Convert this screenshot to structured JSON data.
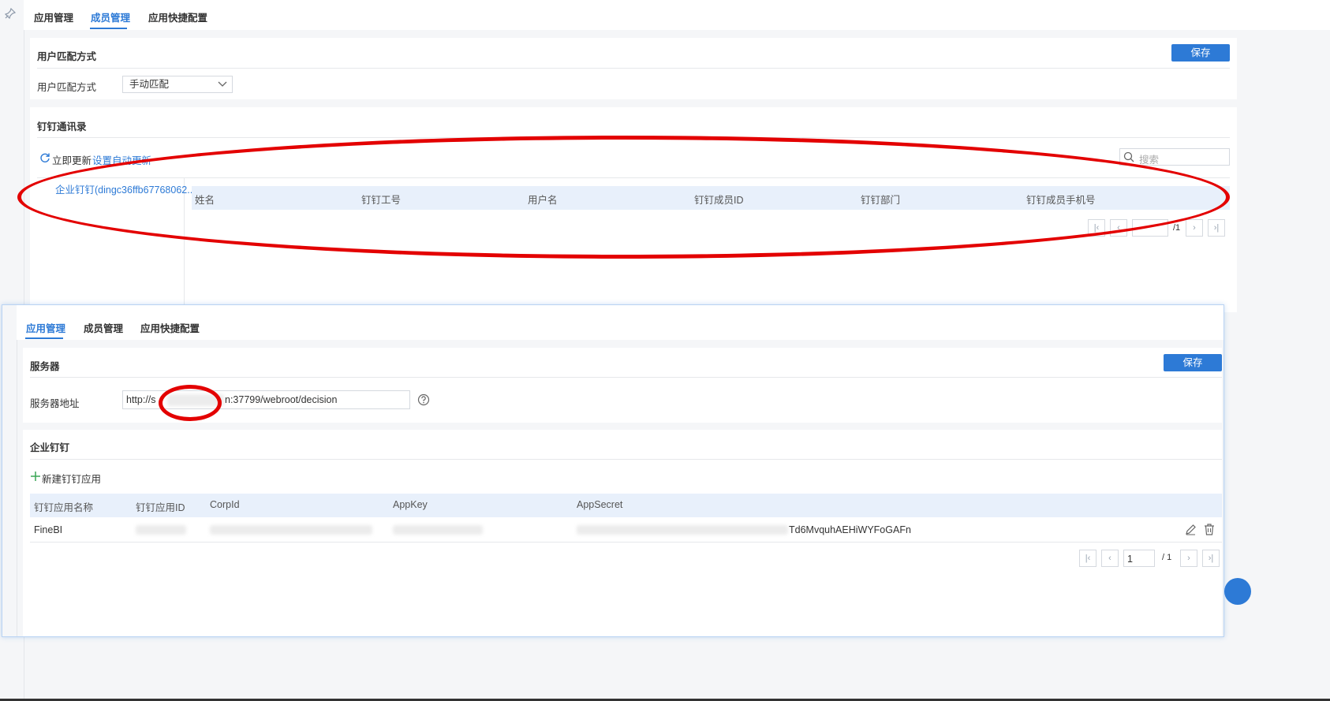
{
  "top": {
    "tabs": [
      "应用管理",
      "成员管理",
      "应用快捷配置"
    ],
    "active_tab": "成员管理",
    "match_section": {
      "title": "用户匹配方式",
      "save_label": "保存",
      "field_label": "用户匹配方式",
      "select_value": "手动匹配"
    },
    "dingtalk_section": {
      "title": "钉钉通讯录",
      "refresh_label": "立即更新",
      "auto_update_label": "设置自动更新",
      "search_placeholder": "搜索",
      "tree_item": "企业钉钉(dingc36ffb67768062...",
      "columns": [
        "姓名",
        "钉钉工号",
        "用户名",
        "钉钉成员ID",
        "钉钉部门",
        "钉钉成员手机号"
      ],
      "page_total": "/1"
    }
  },
  "bottom": {
    "tabs": [
      "应用管理",
      "成员管理",
      "应用快捷配置"
    ],
    "active_tab": "应用管理",
    "server_section": {
      "title": "服务器",
      "save_label": "保存",
      "field_label": "服务器地址",
      "url_prefix": "http://s",
      "url_suffix": "n:37799/webroot/decision"
    },
    "enterprise_section": {
      "title": "企业钉钉",
      "add_label": "新建钉钉应用",
      "columns": [
        "钉钉应用名称",
        "钉钉应用ID",
        "CorpId",
        "AppKey",
        "AppSecret"
      ],
      "row": {
        "name": "FineBI",
        "secret_visible": "Td6MvquhAEHiWYFoGAFn"
      },
      "page_value": "1",
      "page_total": "/ 1"
    }
  },
  "colors": {
    "accent": "#2d7ad6",
    "annotation": "#e30000"
  }
}
